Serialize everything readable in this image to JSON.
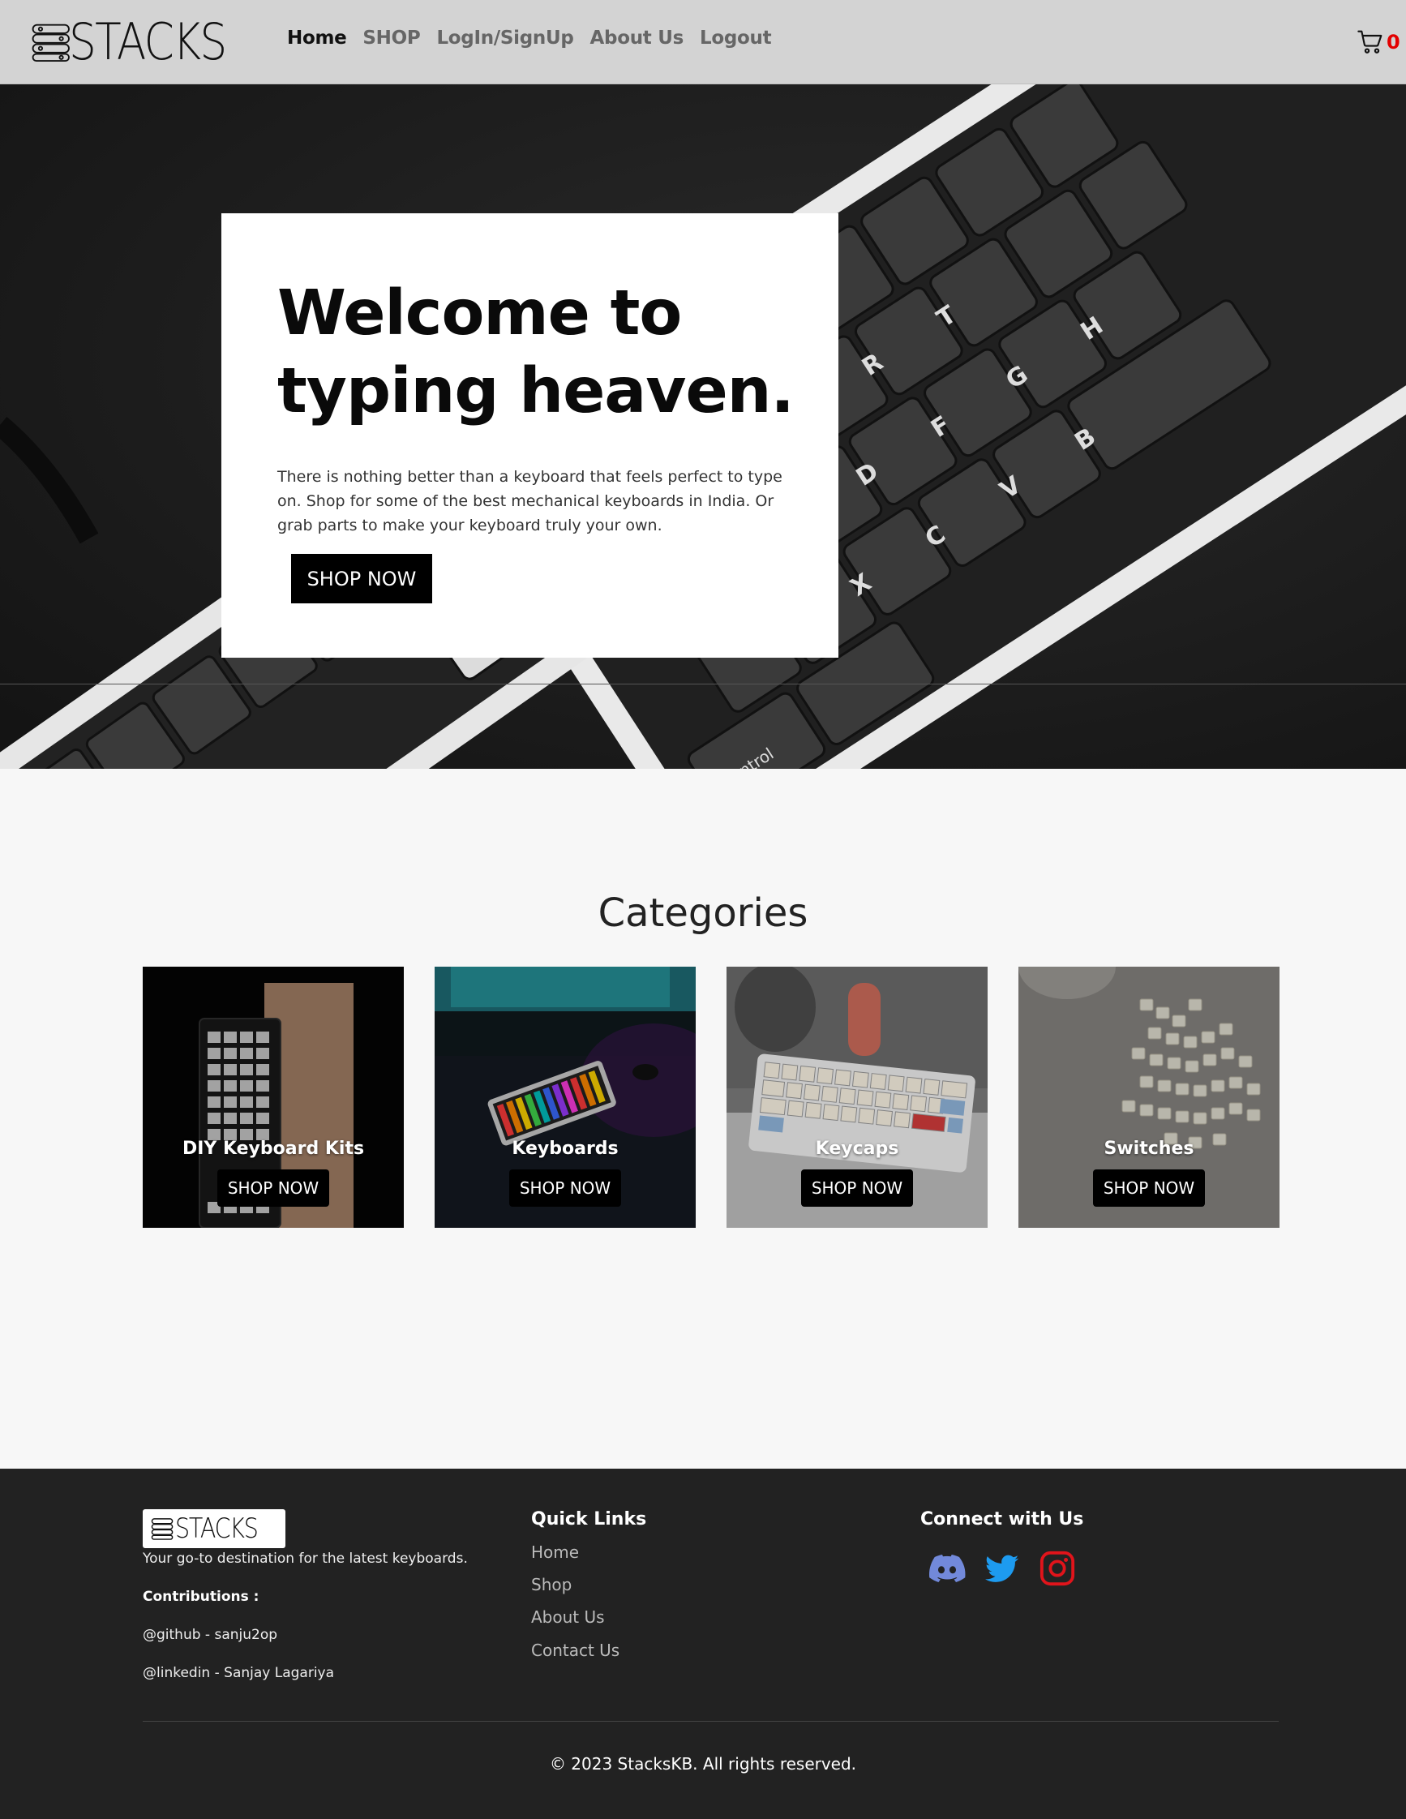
{
  "brand": {
    "name": "STACKS"
  },
  "nav": {
    "links": [
      "Home",
      "SHOP",
      "LogIn/SignUp",
      "About Us",
      "Logout"
    ],
    "active": "Home",
    "cart_count": "0"
  },
  "hero": {
    "title": "Welcome to typing heaven.",
    "description": "There is nothing better than a keyboard that feels perfect to type on. Shop for some of the best mechanical keyboards in India. Or grab parts to make your keyboard truly your own.",
    "button_label": "SHOP NOW"
  },
  "categories": {
    "title": "Categories",
    "items": [
      {
        "name": "DIY Keyboard Kits",
        "button_label": "SHOP NOW"
      },
      {
        "name": "Keyboards",
        "button_label": "SHOP NOW"
      },
      {
        "name": "Keycaps",
        "button_label": "SHOP NOW"
      },
      {
        "name": "Switches",
        "button_label": "SHOP NOW"
      }
    ]
  },
  "footer": {
    "tagline": "Your go-to destination for the latest keyboards.",
    "contributions_label": "Contributions :",
    "github": "@github - sanju2op",
    "linkedin": "@linkedin - Sanjay Lagariya",
    "quick_links_heading": "Quick Links",
    "quick_links": [
      "Home",
      "Shop",
      "About Us",
      "Contact Us"
    ],
    "connect_heading": "Connect with Us",
    "socials": [
      {
        "icon": "discord-icon",
        "color": "#7289da"
      },
      {
        "icon": "twitter-icon",
        "color": "#1d9bf0"
      },
      {
        "icon": "instagram-icon",
        "color": "#e1141b"
      }
    ],
    "copyright": "© 2023 StacksKB. All rights reserved."
  },
  "colors": {
    "navbar_bg": "#d3d3d3",
    "footer_bg": "#222222",
    "accent_red": "#e30000",
    "button_bg": "#000000"
  }
}
